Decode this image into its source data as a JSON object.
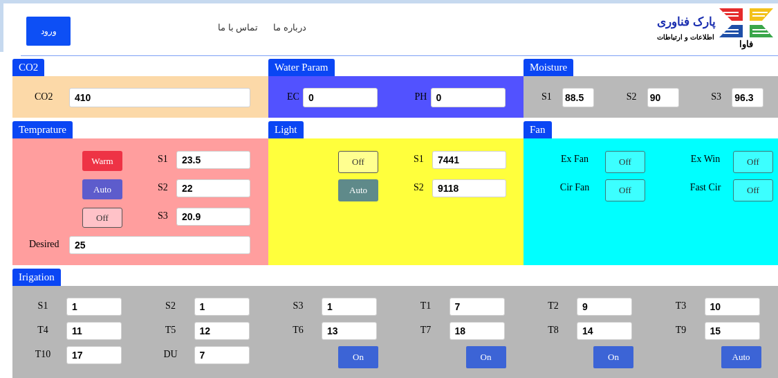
{
  "header": {
    "logo": {
      "title": "پارک فناوری",
      "subtitle": "اطلاعات و ارتباطات",
      "wordmark": "فاوا"
    },
    "nav": [
      "درباره ما",
      "تماس با ما"
    ],
    "login_button": "ورود"
  },
  "panels": [
    {
      "title": "CO2",
      "kind": "co2",
      "color": "#fcd9a8",
      "fields": [
        {
          "label": "CO2",
          "value": "410"
        }
      ]
    },
    {
      "title": "Water Param",
      "kind": "water",
      "color": "#5252ff",
      "fields": [
        {
          "label": "EC",
          "value": "0"
        },
        {
          "label": "PH",
          "value": "0"
        }
      ]
    },
    {
      "title": "Moisture",
      "kind": "moisture",
      "color": "#b9b9b9",
      "fields": [
        {
          "label": "S1",
          "value": "88.5"
        },
        {
          "label": "S2",
          "value": "90"
        },
        {
          "label": "S3",
          "value": "96.3"
        }
      ]
    },
    {
      "title": "Temprature",
      "kind": "temperature",
      "color": "#ff9e9e",
      "buttons": [
        {
          "label": "Warm",
          "color": "#ee3345",
          "selected": false
        },
        {
          "label": "Auto",
          "color": "#5d5ccc",
          "selected": false
        },
        {
          "label": "Off",
          "color": "#ffc2c8",
          "selected": true
        }
      ],
      "fields": [
        {
          "label": "S1",
          "value": "23.5"
        },
        {
          "label": "S2",
          "value": "22"
        },
        {
          "label": "S3",
          "value": "20.9"
        }
      ],
      "desired": {
        "label": "Desired",
        "value": "25"
      }
    },
    {
      "title": "Light",
      "kind": "light",
      "color": "#ffff3c",
      "buttons": [
        {
          "label": "Off",
          "color": "#ffff90",
          "selected": true
        },
        {
          "label": "Auto",
          "color": "#5f8a8a",
          "selected": false
        }
      ],
      "fields": [
        {
          "label": "S1",
          "value": "7441"
        },
        {
          "label": "S2",
          "value": "9118"
        }
      ]
    },
    {
      "title": "Fan",
      "kind": "fan",
      "color": "#00ffff",
      "toggles": [
        {
          "label": "Ex Fan",
          "button": "Off",
          "selected": true
        },
        {
          "label": "Ex Win",
          "button": "Off",
          "selected": true
        },
        {
          "label": "Cir Fan",
          "button": "Off",
          "selected": true
        },
        {
          "label": "Fast Cir",
          "button": "Off",
          "selected": true
        }
      ]
    }
  ],
  "irrigation": {
    "title": "Irigation",
    "color": "#b7b7b7",
    "cells": [
      {
        "kind": "field",
        "label": "S1",
        "value": "1"
      },
      {
        "kind": "field",
        "label": "S2",
        "value": "1"
      },
      {
        "kind": "field",
        "label": "S3",
        "value": "1"
      },
      {
        "kind": "field",
        "label": "T1",
        "value": "7"
      },
      {
        "kind": "field",
        "label": "T2",
        "value": "9"
      },
      {
        "kind": "field",
        "label": "T3",
        "value": "10"
      },
      {
        "kind": "field",
        "label": "T4",
        "value": "11"
      },
      {
        "kind": "field",
        "label": "T5",
        "value": "12"
      },
      {
        "kind": "field",
        "label": "T6",
        "value": "13"
      },
      {
        "kind": "field",
        "label": "T7",
        "value": "18"
      },
      {
        "kind": "field",
        "label": "T8",
        "value": "14"
      },
      {
        "kind": "field",
        "label": "T9",
        "value": "15"
      },
      {
        "kind": "field",
        "label": "T10",
        "value": "17"
      },
      {
        "kind": "field",
        "label": "DU",
        "value": "7"
      },
      {
        "kind": "button",
        "label": "On"
      },
      {
        "kind": "button",
        "label": "On"
      },
      {
        "kind": "button",
        "label": "On"
      },
      {
        "kind": "button",
        "label": "Auto"
      }
    ]
  }
}
